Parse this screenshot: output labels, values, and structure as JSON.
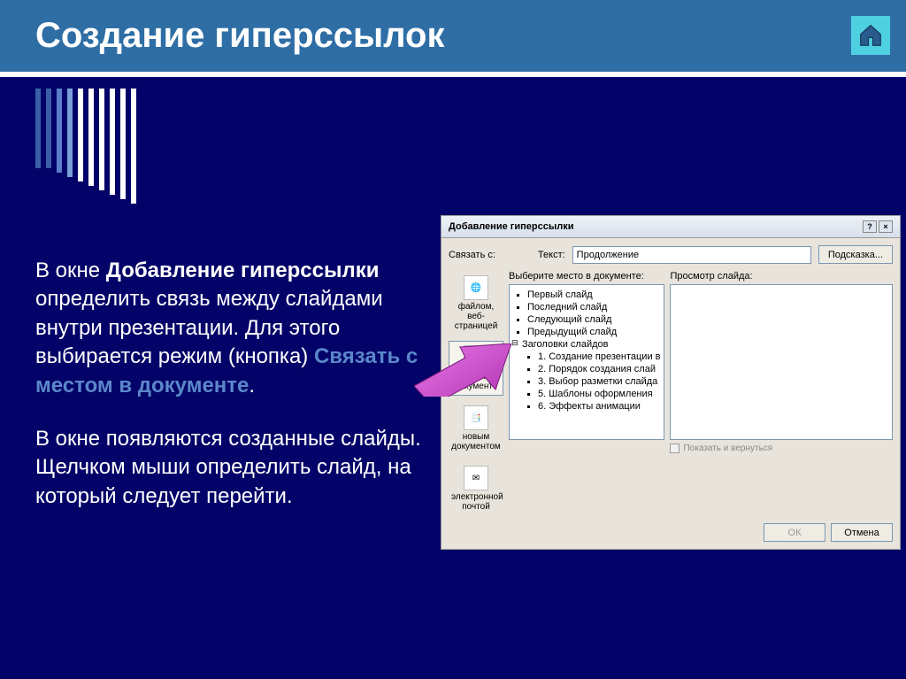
{
  "slide": {
    "title": "Создание гиперссылок",
    "para1_prefix": "В окне ",
    "para1_bold": "Добавление гиперссылки",
    "para1_mid": " определить связь между слайдами внутри презентации. Для этого выбирается режим (кнопка) ",
    "para1_accent": "Связать с местом в документе",
    "para1_end": ".",
    "para2": "В окне появляются созданные слайды. Щелчком мыши определить слайд, на который следует перейти."
  },
  "dialog": {
    "title": "Добавление гиперссылки",
    "link_to_label": "Связать с:",
    "text_label": "Текст:",
    "text_value": "Продолжение",
    "hint_btn": "Подсказка...",
    "select_place_label": "Выберите место в документе:",
    "preview_label": "Просмотр слайда:",
    "show_return": "Показать и вернуться",
    "ok": "ОК",
    "cancel": "Отмена",
    "sidebar": [
      "файлом, веб-страницей",
      "местом в документе",
      "новым документом",
      "электронной почтой"
    ],
    "tree_top": [
      "Первый слайд",
      "Последний слайд",
      "Следующий слайд",
      "Предыдущий слайд"
    ],
    "tree_header": "Заголовки слайдов",
    "tree_sub": [
      "1. Создание презентации в",
      "2. Порядок создания слай",
      "3. Выбор разметки слайда",
      "5. Шаблоны оформления",
      "6. Эффекты анимации"
    ]
  }
}
